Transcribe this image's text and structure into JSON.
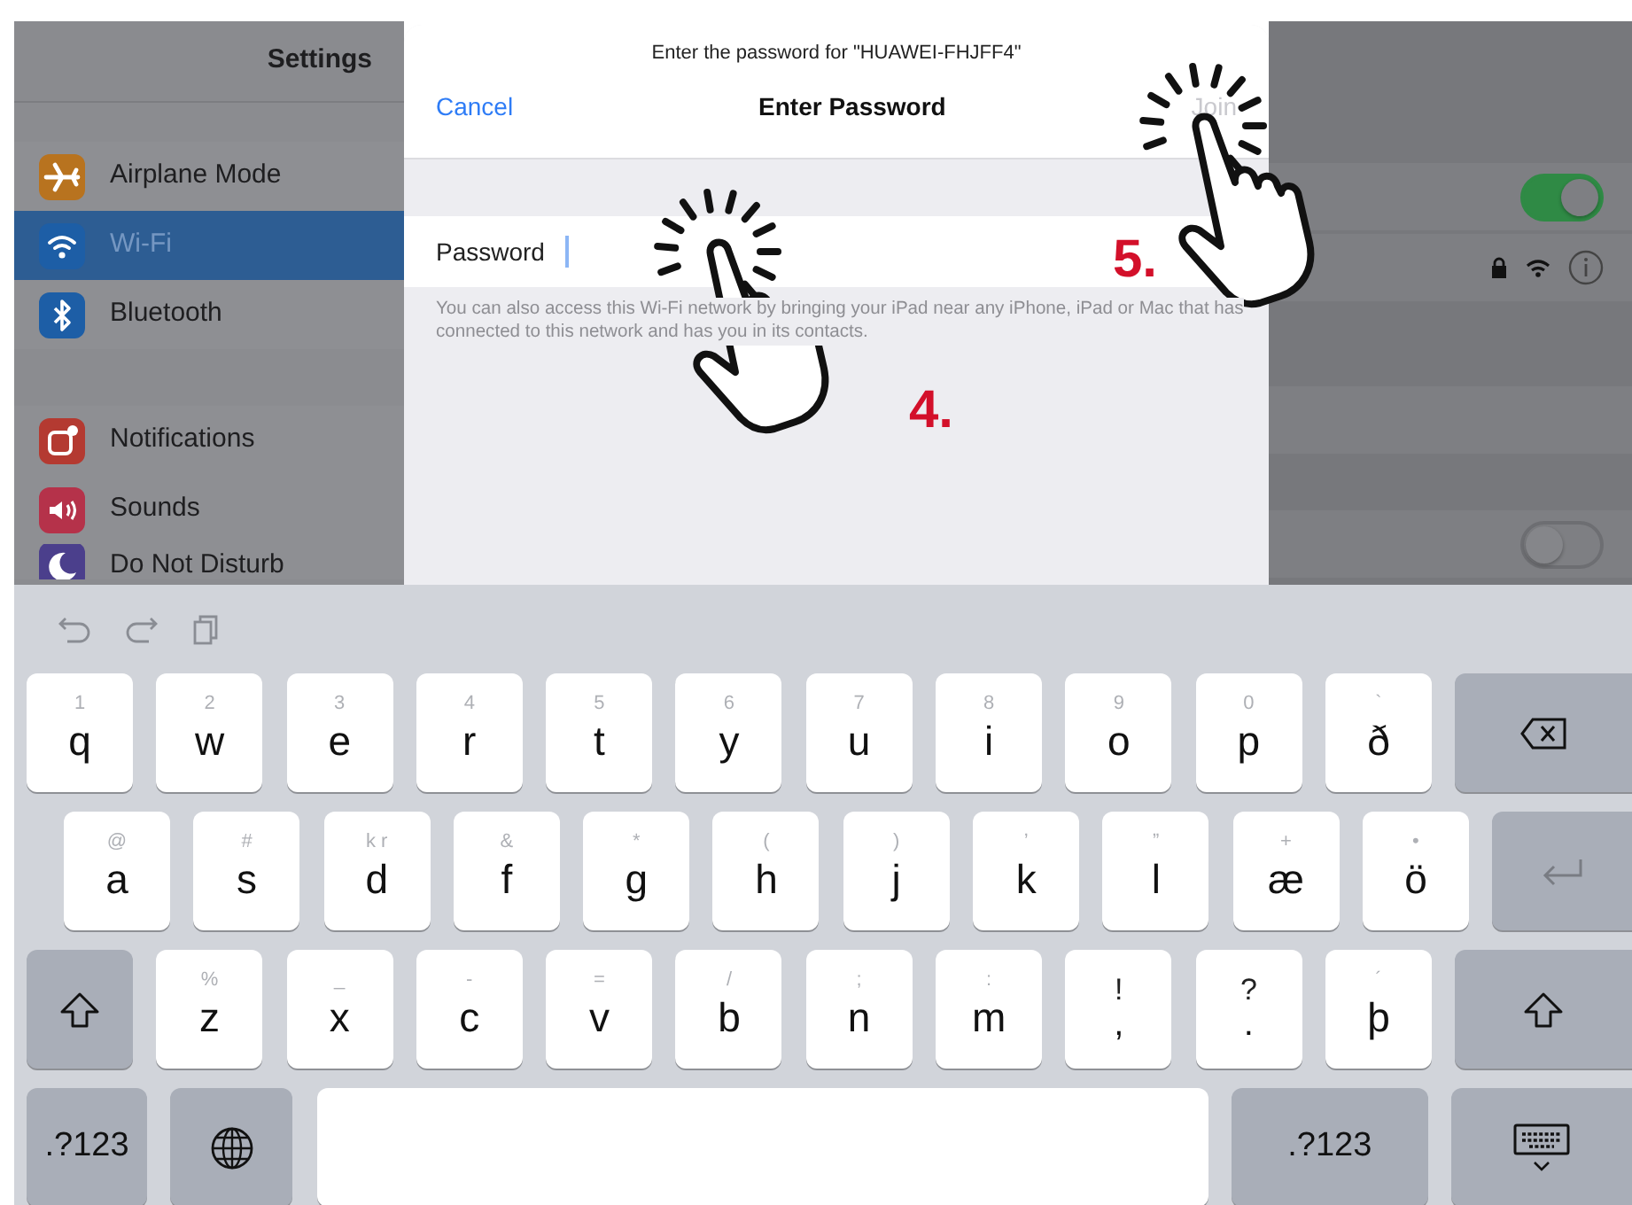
{
  "sidebar": {
    "title": "Settings",
    "groups": [
      {
        "items": [
          {
            "label": "Airplane Mode",
            "color": "#b8731f",
            "selected": false
          },
          {
            "label": "Wi-Fi",
            "color": "#1d5ea6",
            "selected": true
          },
          {
            "label": "Bluetooth",
            "color": "#1d5ea6",
            "selected": false
          }
        ]
      },
      {
        "items": [
          {
            "label": "Notifications",
            "color": "#b43a31",
            "selected": false
          },
          {
            "label": "Sounds",
            "color": "#b5324a",
            "selected": false
          },
          {
            "label": "Do Not Disturb",
            "color": "#4b3f8c",
            "selected": false
          }
        ]
      }
    ]
  },
  "dialog": {
    "subtitle": "Enter the password for \"HUAWEI-FHJFF4\"",
    "cancel": "Cancel",
    "title": "Enter Password",
    "join": {
      "label": "Join",
      "disabled": true
    },
    "field": {
      "label": "Password"
    },
    "footnote": "You can also access this Wi-Fi network by bringing your iPad near any iPhone, iPad or Mac that has connected to this network and has you in its contacts."
  },
  "detail": {
    "toggles": [
      {
        "on": true
      },
      {
        "on": false
      }
    ]
  },
  "keyboard": {
    "rows": [
      [
        {
          "kind": "char",
          "hint": "1",
          "label": "q"
        },
        {
          "kind": "char",
          "hint": "2",
          "label": "w"
        },
        {
          "kind": "char",
          "hint": "3",
          "label": "e"
        },
        {
          "kind": "char",
          "hint": "4",
          "label": "r"
        },
        {
          "kind": "char",
          "hint": "5",
          "label": "t"
        },
        {
          "kind": "char",
          "hint": "6",
          "label": "y"
        },
        {
          "kind": "char",
          "hint": "7",
          "label": "u"
        },
        {
          "kind": "char",
          "hint": "8",
          "label": "i"
        },
        {
          "kind": "char",
          "hint": "9",
          "label": "o"
        },
        {
          "kind": "char",
          "hint": "0",
          "label": "p"
        },
        {
          "kind": "char",
          "hint": "`",
          "label": "ð"
        },
        {
          "kind": "backspace"
        }
      ],
      [
        {
          "kind": "char",
          "hint": "@",
          "label": "a"
        },
        {
          "kind": "char",
          "hint": "#",
          "label": "s"
        },
        {
          "kind": "char",
          "hint": "k r",
          "label": "d"
        },
        {
          "kind": "char",
          "hint": "&",
          "label": "f"
        },
        {
          "kind": "char",
          "hint": "*",
          "label": "g"
        },
        {
          "kind": "char",
          "hint": "(",
          "label": "h"
        },
        {
          "kind": "char",
          "hint": ")",
          "label": "j"
        },
        {
          "kind": "char",
          "hint": "’",
          "label": "k"
        },
        {
          "kind": "char",
          "hint": "”",
          "label": "l"
        },
        {
          "kind": "char",
          "hint": "+",
          "label": "æ"
        },
        {
          "kind": "char",
          "hint": "•",
          "label": "ö"
        },
        {
          "kind": "return",
          "disabled": true
        }
      ],
      [
        {
          "kind": "shift"
        },
        {
          "kind": "char",
          "hint": "%",
          "label": "z"
        },
        {
          "kind": "char",
          "hint": "_",
          "label": "x"
        },
        {
          "kind": "char",
          "hint": "-",
          "label": "c"
        },
        {
          "kind": "char",
          "hint": "=",
          "label": "v"
        },
        {
          "kind": "char",
          "hint": "/",
          "label": "b"
        },
        {
          "kind": "char",
          "hint": ";",
          "label": "n"
        },
        {
          "kind": "char",
          "hint": ":",
          "label": "m"
        },
        {
          "kind": "punct",
          "hint": "!",
          "label": ","
        },
        {
          "kind": "punct",
          "hint": "?",
          "label": "."
        },
        {
          "kind": "char",
          "hint": "´",
          "label": "þ"
        },
        {
          "kind": "shift"
        }
      ],
      [
        {
          "kind": "mode",
          "label": ".?123"
        },
        {
          "kind": "globe"
        },
        {
          "kind": "space"
        },
        {
          "kind": "mode",
          "label": ".?123"
        },
        {
          "kind": "dismiss"
        }
      ]
    ]
  },
  "annotations": [
    {
      "label": "4."
    },
    {
      "label": "5."
    }
  ]
}
